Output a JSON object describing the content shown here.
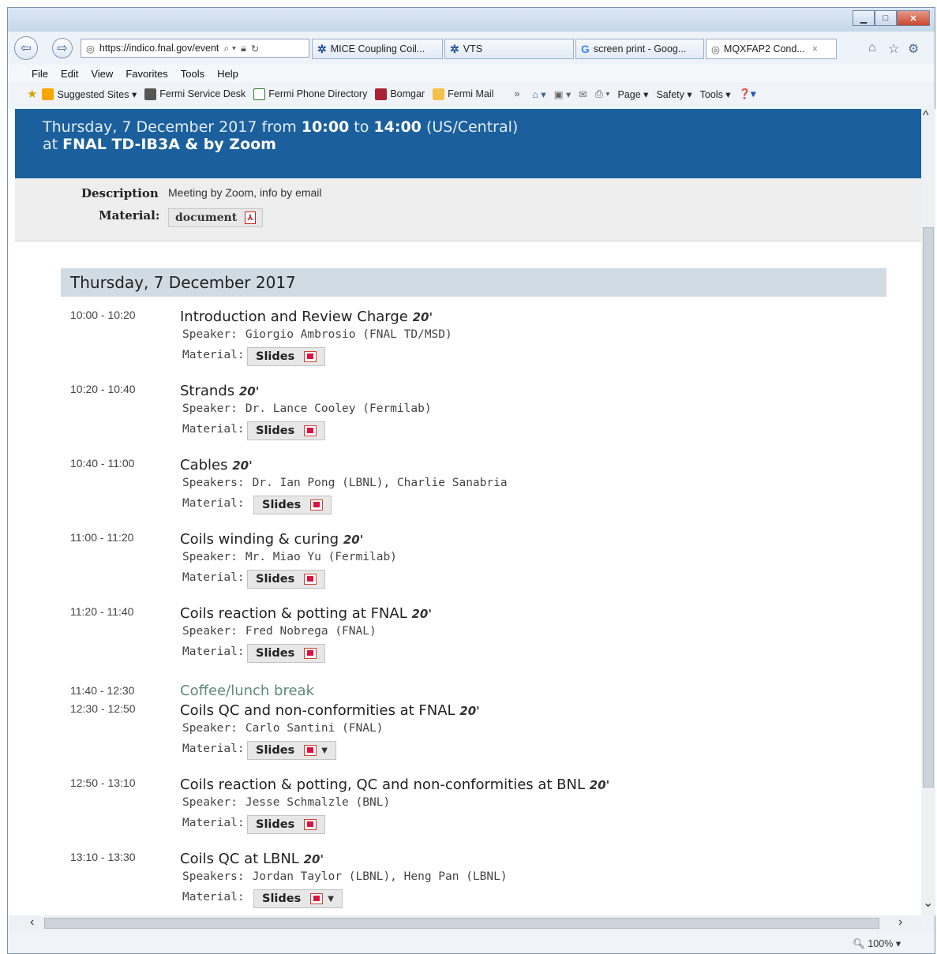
{
  "browser": {
    "address": "https://indico.fnal.gov/event",
    "tabs": [
      {
        "label": "MICE Coupling Coil...",
        "icon": "fnal-icon"
      },
      {
        "label": "VTS",
        "icon": "fnal-icon"
      },
      {
        "label": "screen print - Goog...",
        "icon": "google-icon"
      },
      {
        "label": "MQXFAP2 Cond...",
        "icon": "indico-icon",
        "close": "×"
      }
    ],
    "menu": [
      "File",
      "Edit",
      "View",
      "Favorites",
      "Tools",
      "Help"
    ],
    "favorites": [
      "Suggested Sites ▾",
      "Fermi Service Desk",
      "Fermi Phone Directory",
      "Bomgar",
      "Fermi Mail"
    ],
    "commands": [
      "Page ▾",
      "Safety ▾",
      "Tools ▾"
    ],
    "zoom": "100%"
  },
  "event": {
    "date_prefix": "Thursday, 7 December 2017 from ",
    "start": "10:00",
    "to": " to ",
    "end": "14:00",
    "tz": " (US/Central)",
    "at_prefix": "at ",
    "location": "FNAL TD-IB3A & by Zoom",
    "description_label": "Description",
    "description": "Meeting by Zoom, info by email",
    "material_label": "Material:",
    "material_button": "document"
  },
  "day_heading": "Thursday, 7 December 2017",
  "labels": {
    "speaker": "Speaker:",
    "speakers": "Speakers:",
    "material": "Material:",
    "slides": "Slides"
  },
  "entries": [
    {
      "time": "10:00 - 10:20",
      "title": "Introduction and Review Charge",
      "dur": "20'",
      "spk_label": "Speaker:",
      "speaker": "Giorgio Ambrosio (FNAL TD/MSD)"
    },
    {
      "time": "10:20 - 10:40",
      "title": "Strands",
      "dur": "20'",
      "spk_label": "Speaker:",
      "speaker": "Dr. Lance Cooley (Fermilab)"
    },
    {
      "time": "10:40 - 11:00",
      "title": "Cables",
      "dur": "20'",
      "spk_label": "Speakers:",
      "speaker": "Dr. Ian Pong (LBNL), Charlie Sanabria"
    },
    {
      "time": "11:00 - 11:20",
      "title": "Coils winding & curing",
      "dur": "20'",
      "spk_label": "Speaker:",
      "speaker": "Mr. Miao Yu (Fermilab)"
    },
    {
      "time": "11:20 - 11:40",
      "title": "Coils reaction & potting at FNAL",
      "dur": "20'",
      "spk_label": "Speaker:",
      "speaker": "Fred Nobrega (FNAL)"
    },
    {
      "time": "12:30 - 12:50",
      "title": "Coils QC and non-conformities at FNAL",
      "dur": "20'",
      "spk_label": "Speaker:",
      "speaker": "Carlo Santini (FNAL)"
    },
    {
      "time": "12:50 - 13:10",
      "title": "Coils reaction & potting, QC and non-conformities at BNL",
      "dur": "20'",
      "spk_label": "Speaker:",
      "speaker": "Jesse Schmalzle (BNL)"
    },
    {
      "time": "13:10 - 13:30",
      "title": "Coils QC at LBNL",
      "dur": "20'",
      "spk_label": "Speakers:",
      "speaker": "Jordan Taylor (LBNL), Heng Pan (LBNL)"
    }
  ],
  "break": {
    "time": "11:40 - 12:30",
    "title": "Coffee/lunch break"
  }
}
